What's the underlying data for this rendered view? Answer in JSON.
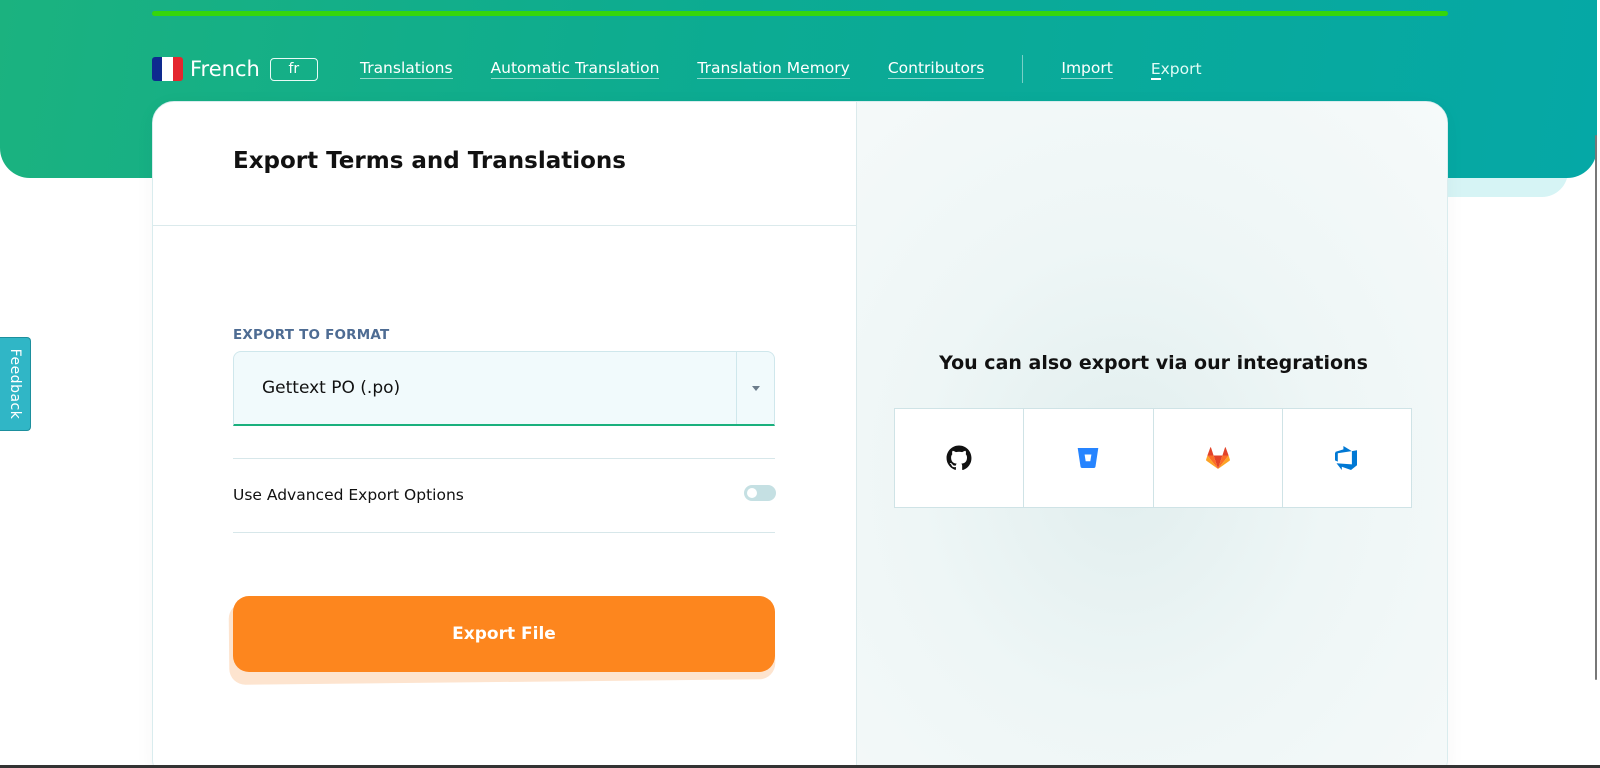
{
  "header": {
    "language_name": "French",
    "language_code": "fr",
    "nav": [
      {
        "label": "Translations"
      },
      {
        "label": "Automatic Translation"
      },
      {
        "label": "Translation Memory"
      },
      {
        "label": "Contributors"
      },
      {
        "label": "Import"
      },
      {
        "label": "Export",
        "active": true
      }
    ]
  },
  "main": {
    "title": "Export Terms and Translations",
    "format_label": "EXPORT TO FORMAT",
    "format_value": "Gettext PO (.po)",
    "advanced_label": "Use Advanced Export Options",
    "advanced_enabled": false,
    "export_button": "Export File"
  },
  "integrations": {
    "title": "You can also export via our integrations",
    "items": [
      {
        "icon": "github-icon"
      },
      {
        "icon": "bitbucket-icon"
      },
      {
        "icon": "gitlab-icon"
      },
      {
        "icon": "azure-devops-icon"
      }
    ]
  },
  "feedback_label": "Feedback",
  "colors": {
    "brand_green": "#1bb27f",
    "accent_orange": "#fd861e",
    "progress_green": "#35d60b",
    "feedback_teal": "#30b6c6"
  }
}
